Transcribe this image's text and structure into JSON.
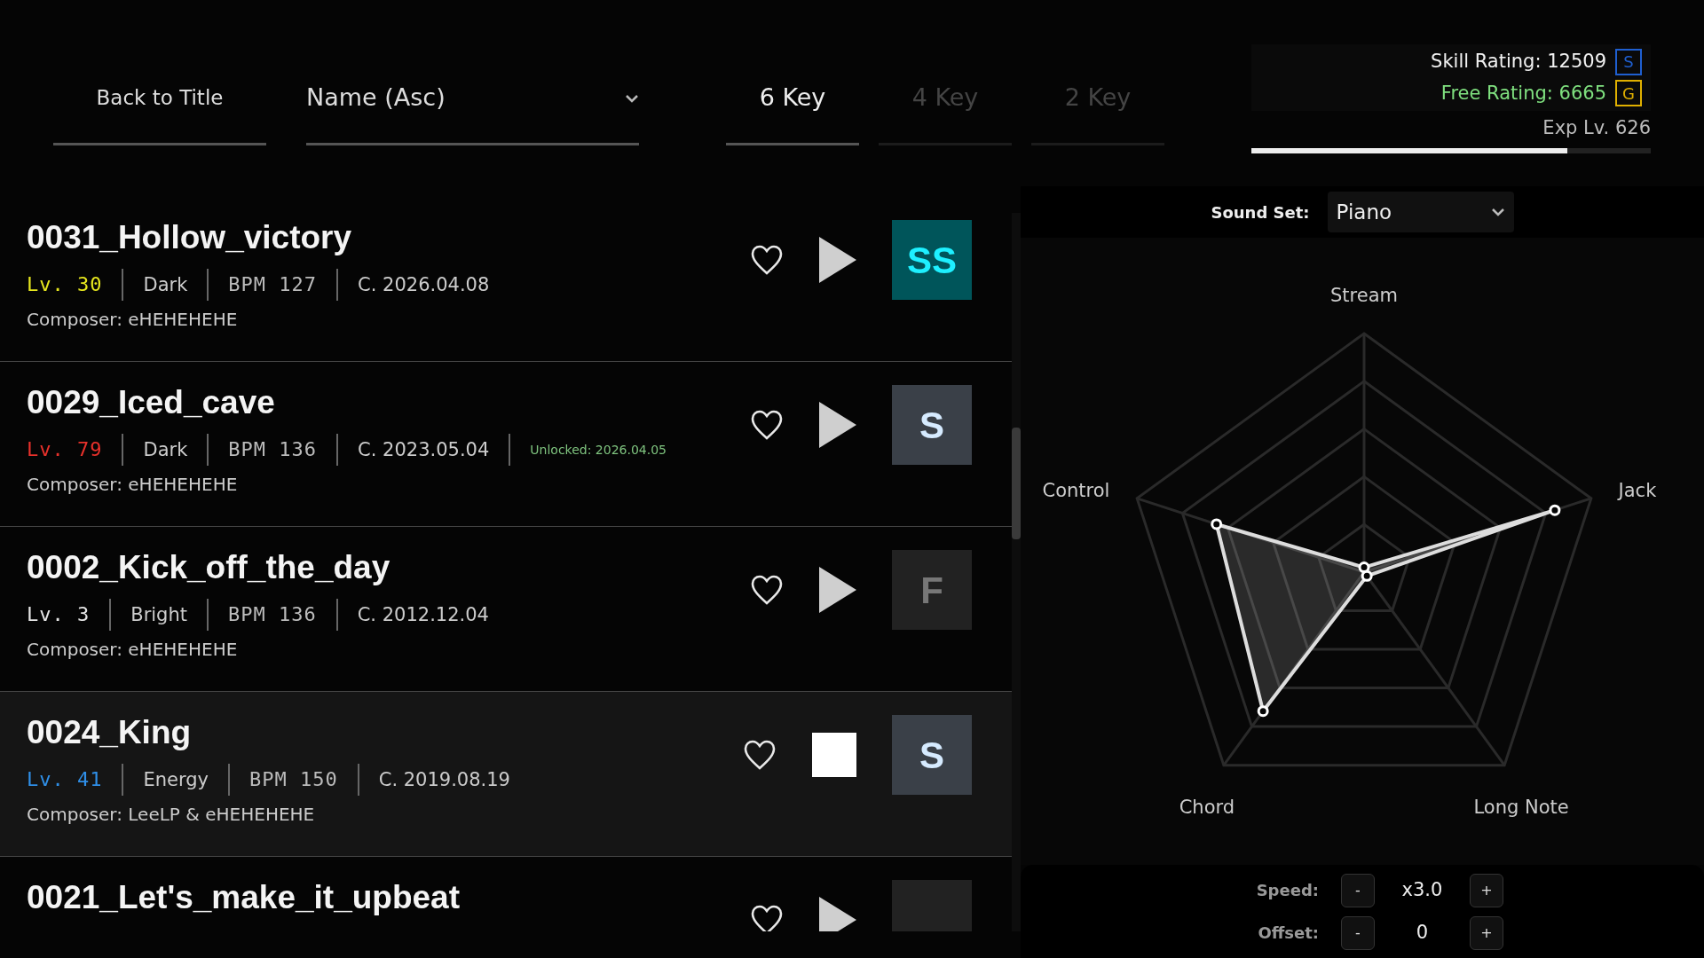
{
  "header": {
    "back_button": "Back to Title",
    "sort": {
      "value": "Name (Asc)"
    },
    "tabs": [
      {
        "label": "6 Key",
        "selected": true
      },
      {
        "label": "4 Key",
        "selected": false
      },
      {
        "label": "2 Key",
        "selected": false
      }
    ]
  },
  "ratings": [
    {
      "kind": "skill",
      "label": "Skill Rating: 12509",
      "badge": "S"
    },
    {
      "kind": "free",
      "label": "Free Rating: 6665",
      "badge": "G"
    }
  ],
  "exp": {
    "label": "Exp Lv. 626",
    "level": 0.79
  },
  "songs": [
    {
      "title": "0031_Hollow_victory",
      "level": "Lv. 30",
      "color": "#e6e61e",
      "mood": "Dark",
      "bpm": "BPM 127",
      "created": "C. 2026.04.08",
      "composer": "Composer: eHEHEHEHE",
      "playing": false,
      "rank": "SS",
      "selected": false
    },
    {
      "title": "0029_Iced_cave",
      "level": "Lv. 79",
      "color": "#e8312b",
      "mood": "Dark",
      "bpm": "BPM 136",
      "created": "C. 2023.05.04",
      "unlocked": "Unlocked: 2026.04.05",
      "composer": "Composer: eHEHEHEHE",
      "playing": false,
      "rank": "S",
      "selected": false
    },
    {
      "title": "0002_Kick_off_the_day",
      "level": "Lv. 3",
      "color": "#e6e6e6",
      "mood": "Bright",
      "bpm": "BPM 136",
      "created": "C. 2012.12.04",
      "composer": "Composer: eHEHEHEHE",
      "playing": false,
      "rank": "F",
      "selected": false
    },
    {
      "title": "0024_King",
      "level": "Lv. 41",
      "color": "#2f8fe8",
      "mood": "Energy",
      "bpm": "BPM 150",
      "created": "C. 2019.08.19",
      "composer": "Composer: LeeLP & eHEHEHEHE",
      "playing": true,
      "rank": "S",
      "selected": true
    },
    {
      "title": "0021_Let's_make_it_upbeat",
      "playing": false,
      "selected": false
    }
  ],
  "sound_set": {
    "label": "Sound Set:",
    "value": "Piano"
  },
  "radar": {
    "axes": [
      "Stream",
      "Jack",
      "Long Note",
      "Chord",
      "Control"
    ]
  },
  "speed": {
    "label": "Speed:",
    "value": "x3.0",
    "decrease": "-",
    "increase": "+"
  },
  "offset": {
    "label": "Offset:",
    "value": "0",
    "decrease": "-",
    "increase": "+"
  }
}
